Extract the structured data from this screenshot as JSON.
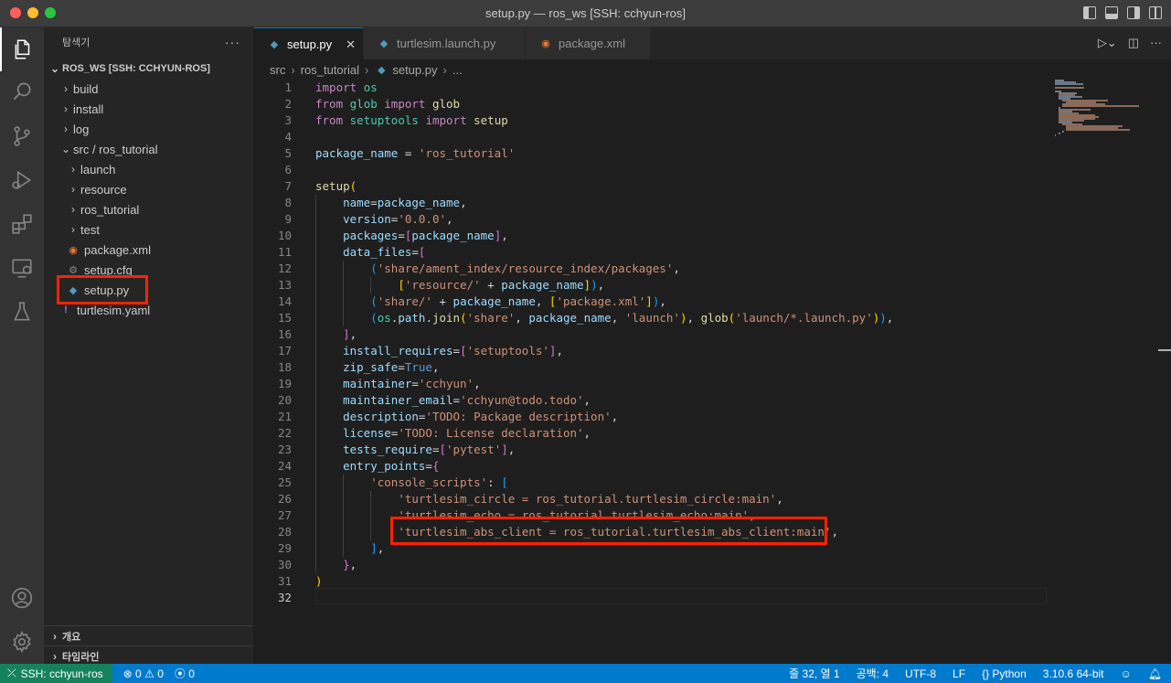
{
  "window": {
    "title": "setup.py — ros_ws [SSH: cchyun-ros]"
  },
  "activity_bar": {
    "icons": [
      "explorer-icon",
      "search-icon",
      "source-control-icon",
      "run-debug-icon",
      "extensions-icon",
      "remote-explorer-icon",
      "testing-icon",
      "account-icon",
      "manage-gear-icon"
    ]
  },
  "sidebar": {
    "title": "탐색기",
    "more": "···",
    "root": "ROS_WS [SSH: CCHYUN-ROS]",
    "items": [
      {
        "label": "build"
      },
      {
        "label": "install"
      },
      {
        "label": "log"
      },
      {
        "label": "src / ros_tutorial"
      },
      {
        "label": "launch"
      },
      {
        "label": "resource"
      },
      {
        "label": "ros_tutorial"
      },
      {
        "label": "test"
      },
      {
        "label": "package.xml"
      },
      {
        "label": "setup.cfg"
      },
      {
        "label": "setup.py"
      },
      {
        "label": "turtlesim.yaml"
      }
    ],
    "panels": [
      {
        "label": "개요"
      },
      {
        "label": "타임라인"
      }
    ]
  },
  "tabs": [
    {
      "label": "setup.py",
      "active": true
    },
    {
      "label": "turtlesim.launch.py"
    },
    {
      "label": "package.xml"
    }
  ],
  "breadcrumb": {
    "items": [
      "src",
      "ros_tutorial",
      "setup.py",
      "..."
    ]
  },
  "editor": {
    "line_numbers": [
      "1",
      "2",
      "3",
      "4",
      "5",
      "6",
      "7",
      "8",
      "9",
      "10",
      "11",
      "12",
      "13",
      "14",
      "15",
      "16",
      "17",
      "18",
      "19",
      "20",
      "21",
      "22",
      "23",
      "24",
      "25",
      "26",
      "27",
      "28",
      "29",
      "30",
      "31",
      "32"
    ],
    "current_line": 32,
    "lines": [
      "import os",
      "from glob import glob",
      "from setuptools import setup",
      "",
      "package_name = 'ros_tutorial'",
      "",
      "setup(",
      "    name=package_name,",
      "    version='0.0.0',",
      "    packages=[package_name],",
      "    data_files=[",
      "        ('share/ament_index/resource_index/packages',",
      "            ['resource/' + package_name]),",
      "        ('share/' + package_name, ['package.xml']),",
      "        (os.path.join('share', package_name, 'launch'), glob('launch/*.launch.py')),",
      "    ],",
      "    install_requires=['setuptools'],",
      "    zip_safe=True,",
      "    maintainer='cchyun',",
      "    maintainer_email='cchyun@todo.todo',",
      "    description='TODO: Package description',",
      "    license='TODO: License declaration',",
      "    tests_require=['pytest'],",
      "    entry_points={",
      "        'console_scripts': [",
      "            'turtlesim_circle = ros_tutorial.turtlesim_circle:main',",
      "            'turtlesim_echo = ros_tutorial.turtlesim_echo:main',",
      "            'turtlesim_abs_client = ros_tutorial.turtlesim_abs_client:main',",
      "        ],",
      "    },",
      ")",
      ""
    ]
  },
  "statusbar": {
    "remote": "SSH: cchyun-ros",
    "errors": "0",
    "warnings": "0",
    "ports": "0",
    "position": "줄 32, 열 1",
    "spaces": "공백: 4",
    "encoding": "UTF-8",
    "eol": "LF",
    "language": "Python",
    "interpreter": "3.10.6 64-bit"
  },
  "colors": {
    "statusbar": "#007acc",
    "remote": "#16825d",
    "annotation": "#ff2200"
  }
}
